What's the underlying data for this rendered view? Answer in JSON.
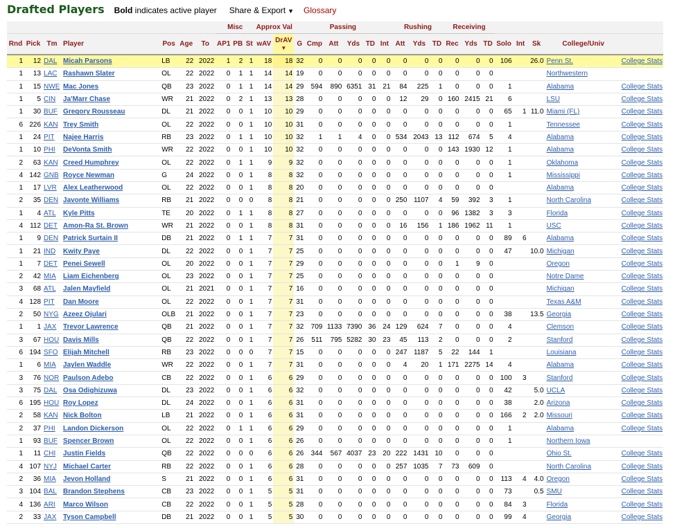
{
  "header": {
    "title": "Drafted Players",
    "note_bold": "Bold",
    "note_rest": " indicates active player",
    "share_label": "Share & Export",
    "glossary_label": "Glossary"
  },
  "groups": {
    "misc": "Misc",
    "approx": "Approx Val",
    "passing": "Passing",
    "rushing": "Rushing",
    "receiving": "Receiving"
  },
  "columns": [
    "Rnd",
    "Pick",
    "Tm",
    "Player",
    "Pos",
    "Age",
    "To",
    "AP1",
    "PB",
    "St",
    "wAV",
    "DrAV",
    "G",
    "Cmp",
    "Att",
    "Yds",
    "TD",
    "Int",
    "Att",
    "Yds",
    "TD",
    "Rec",
    "Yds",
    "TD",
    "Solo",
    "Int",
    "Sk",
    "College/Univ",
    ""
  ],
  "sort_arrow": "▼",
  "college_stats_label": "College Stats",
  "rows": [
    [
      "1",
      "12",
      "DAL",
      "Micah Parsons",
      "LB",
      "22",
      "2022",
      "1",
      "2",
      "1",
      "18",
      "18",
      "32",
      "0",
      "0",
      "0",
      "0",
      "0",
      "0",
      "0",
      "0",
      "0",
      "0",
      "0",
      "106",
      "",
      "26.0",
      "Penn St.",
      "y"
    ],
    [
      "1",
      "13",
      "LAC",
      "Rashawn Slater",
      "OL",
      "22",
      "2022",
      "0",
      "1",
      "1",
      "14",
      "14",
      "19",
      "0",
      "0",
      "0",
      "0",
      "0",
      "0",
      "0",
      "0",
      "0",
      "0",
      "0",
      "",
      "",
      "",
      "Northwestern",
      "n"
    ],
    [
      "1",
      "15",
      "NWE",
      "Mac Jones",
      "QB",
      "23",
      "2022",
      "0",
      "1",
      "1",
      "14",
      "14",
      "29",
      "594",
      "890",
      "6351",
      "31",
      "21",
      "84",
      "225",
      "1",
      "0",
      "0",
      "0",
      "1",
      "",
      "",
      "Alabama",
      "y"
    ],
    [
      "1",
      "5",
      "CIN",
      "Ja'Marr Chase",
      "WR",
      "21",
      "2022",
      "0",
      "2",
      "1",
      "13",
      "13",
      "28",
      "0",
      "0",
      "0",
      "0",
      "0",
      "12",
      "29",
      "0",
      "160",
      "2415",
      "21",
      "6",
      "",
      "",
      "LSU",
      "y"
    ],
    [
      "1",
      "30",
      "BUF",
      "Gregory Rousseau",
      "DL",
      "21",
      "2022",
      "0",
      "0",
      "1",
      "10",
      "10",
      "29",
      "0",
      "0",
      "0",
      "0",
      "0",
      "0",
      "0",
      "0",
      "0",
      "0",
      "0",
      "65",
      "1",
      "11.0",
      "Miami (FL)",
      "y"
    ],
    [
      "6",
      "226",
      "KAN",
      "Trey Smith",
      "OL",
      "22",
      "2022",
      "0",
      "0",
      "1",
      "10",
      "10",
      "31",
      "0",
      "0",
      "0",
      "0",
      "0",
      "0",
      "0",
      "0",
      "0",
      "0",
      "0",
      "1",
      "",
      "",
      "Tennessee",
      "y"
    ],
    [
      "1",
      "24",
      "PIT",
      "Najee Harris",
      "RB",
      "23",
      "2022",
      "0",
      "1",
      "1",
      "10",
      "10",
      "32",
      "1",
      "1",
      "4",
      "0",
      "0",
      "534",
      "2043",
      "13",
      "112",
      "674",
      "5",
      "4",
      "",
      "",
      "Alabama",
      "y"
    ],
    [
      "1",
      "10",
      "PHI",
      "DeVonta Smith",
      "WR",
      "22",
      "2022",
      "0",
      "0",
      "1",
      "10",
      "10",
      "32",
      "0",
      "0",
      "0",
      "0",
      "0",
      "0",
      "0",
      "0",
      "143",
      "1930",
      "12",
      "1",
      "",
      "",
      "Alabama",
      "y"
    ],
    [
      "2",
      "63",
      "KAN",
      "Creed Humphrey",
      "OL",
      "22",
      "2022",
      "0",
      "1",
      "1",
      "9",
      "9",
      "32",
      "0",
      "0",
      "0",
      "0",
      "0",
      "0",
      "0",
      "0",
      "0",
      "0",
      "0",
      "1",
      "",
      "",
      "Oklahoma",
      "y"
    ],
    [
      "4",
      "142",
      "GNB",
      "Royce Newman",
      "G",
      "24",
      "2022",
      "0",
      "0",
      "1",
      "8",
      "8",
      "32",
      "0",
      "0",
      "0",
      "0",
      "0",
      "0",
      "0",
      "0",
      "0",
      "0",
      "0",
      "1",
      "",
      "",
      "Mississippi",
      "y"
    ],
    [
      "1",
      "17",
      "LVR",
      "Alex Leatherwood",
      "OL",
      "22",
      "2022",
      "0",
      "0",
      "1",
      "8",
      "8",
      "20",
      "0",
      "0",
      "0",
      "0",
      "0",
      "0",
      "0",
      "0",
      "0",
      "0",
      "0",
      "",
      "",
      "",
      "Alabama",
      "y"
    ],
    [
      "2",
      "35",
      "DEN",
      "Javonte Williams",
      "RB",
      "21",
      "2022",
      "0",
      "0",
      "0",
      "8",
      "8",
      "21",
      "0",
      "0",
      "0",
      "0",
      "0",
      "250",
      "1107",
      "4",
      "59",
      "392",
      "3",
      "1",
      "",
      "",
      "North Carolina",
      "y"
    ],
    [
      "1",
      "4",
      "ATL",
      "Kyle Pitts",
      "TE",
      "20",
      "2022",
      "0",
      "1",
      "1",
      "8",
      "8",
      "27",
      "0",
      "0",
      "0",
      "0",
      "0",
      "0",
      "0",
      "0",
      "96",
      "1382",
      "3",
      "3",
      "",
      "",
      "Florida",
      "y"
    ],
    [
      "4",
      "112",
      "DET",
      "Amon-Ra St. Brown",
      "WR",
      "21",
      "2022",
      "0",
      "0",
      "1",
      "8",
      "8",
      "31",
      "0",
      "0",
      "0",
      "0",
      "0",
      "16",
      "156",
      "1",
      "186",
      "1962",
      "11",
      "1",
      "",
      "",
      "USC",
      "y"
    ],
    [
      "1",
      "9",
      "DEN",
      "Patrick Surtain II",
      "DB",
      "21",
      "2022",
      "0",
      "1",
      "1",
      "7",
      "7",
      "31",
      "0",
      "0",
      "0",
      "0",
      "0",
      "0",
      "0",
      "0",
      "0",
      "0",
      "0",
      "89",
      "6",
      "",
      "Alabama",
      "y"
    ],
    [
      "1",
      "21",
      "IND",
      "Kwity Paye",
      "DL",
      "22",
      "2022",
      "0",
      "0",
      "1",
      "7",
      "7",
      "25",
      "0",
      "0",
      "0",
      "0",
      "0",
      "0",
      "0",
      "0",
      "0",
      "0",
      "0",
      "47",
      "",
      "10.0",
      "Michigan",
      "y"
    ],
    [
      "1",
      "7",
      "DET",
      "Penei Sewell",
      "OL",
      "20",
      "2022",
      "0",
      "0",
      "1",
      "7",
      "7",
      "29",
      "0",
      "0",
      "0",
      "0",
      "0",
      "0",
      "0",
      "0",
      "1",
      "9",
      "0",
      "",
      "",
      "",
      "Oregon",
      "y"
    ],
    [
      "2",
      "42",
      "MIA",
      "Liam Eichenberg",
      "OL",
      "23",
      "2022",
      "0",
      "0",
      "1",
      "7",
      "7",
      "25",
      "0",
      "0",
      "0",
      "0",
      "0",
      "0",
      "0",
      "0",
      "0",
      "0",
      "0",
      "",
      "",
      "",
      "Notre Dame",
      "y"
    ],
    [
      "3",
      "68",
      "ATL",
      "Jalen Mayfield",
      "OL",
      "21",
      "2021",
      "0",
      "0",
      "1",
      "7",
      "7",
      "16",
      "0",
      "0",
      "0",
      "0",
      "0",
      "0",
      "0",
      "0",
      "0",
      "0",
      "0",
      "",
      "",
      "",
      "Michigan",
      "y"
    ],
    [
      "4",
      "128",
      "PIT",
      "Dan Moore",
      "OL",
      "22",
      "2022",
      "0",
      "0",
      "1",
      "7",
      "7",
      "31",
      "0",
      "0",
      "0",
      "0",
      "0",
      "0",
      "0",
      "0",
      "0",
      "0",
      "0",
      "",
      "",
      "",
      "Texas A&M",
      "y"
    ],
    [
      "2",
      "50",
      "NYG",
      "Azeez Ojulari",
      "OLB",
      "21",
      "2022",
      "0",
      "0",
      "1",
      "7",
      "7",
      "23",
      "0",
      "0",
      "0",
      "0",
      "0",
      "0",
      "0",
      "0",
      "0",
      "0",
      "0",
      "38",
      "",
      "13.5",
      "Georgia",
      "y"
    ],
    [
      "1",
      "1",
      "JAX",
      "Trevor Lawrence",
      "QB",
      "21",
      "2022",
      "0",
      "0",
      "1",
      "7",
      "7",
      "32",
      "709",
      "1133",
      "7390",
      "36",
      "24",
      "129",
      "624",
      "7",
      "0",
      "0",
      "0",
      "4",
      "",
      "",
      "Clemson",
      "y"
    ],
    [
      "3",
      "67",
      "HOU",
      "Davis Mills",
      "QB",
      "22",
      "2022",
      "0",
      "0",
      "1",
      "7",
      "7",
      "26",
      "511",
      "795",
      "5282",
      "30",
      "23",
      "45",
      "113",
      "2",
      "0",
      "0",
      "0",
      "2",
      "",
      "",
      "Stanford",
      "y"
    ],
    [
      "6",
      "194",
      "SFO",
      "Elijah Mitchell",
      "RB",
      "23",
      "2022",
      "0",
      "0",
      "0",
      "7",
      "7",
      "15",
      "0",
      "0",
      "0",
      "0",
      "0",
      "247",
      "1187",
      "5",
      "22",
      "144",
      "1",
      "",
      "",
      "",
      "Louisiana",
      "y"
    ],
    [
      "1",
      "6",
      "MIA",
      "Jaylen Waddle",
      "WR",
      "22",
      "2022",
      "0",
      "0",
      "1",
      "7",
      "7",
      "31",
      "0",
      "0",
      "0",
      "0",
      "0",
      "4",
      "20",
      "1",
      "171",
      "2275",
      "14",
      "4",
      "",
      "",
      "Alabama",
      "y"
    ],
    [
      "3",
      "76",
      "NOR",
      "Paulson Adebo",
      "CB",
      "22",
      "2022",
      "0",
      "0",
      "1",
      "6",
      "6",
      "29",
      "0",
      "0",
      "0",
      "0",
      "0",
      "0",
      "0",
      "0",
      "0",
      "0",
      "0",
      "100",
      "3",
      "",
      "Stanford",
      "y"
    ],
    [
      "3",
      "75",
      "DAL",
      "Osa Odighizuwa",
      "DL",
      "23",
      "2022",
      "0",
      "0",
      "1",
      "6",
      "6",
      "32",
      "0",
      "0",
      "0",
      "0",
      "0",
      "0",
      "0",
      "0",
      "0",
      "0",
      "0",
      "42",
      "",
      "5.0",
      "UCLA",
      "y"
    ],
    [
      "6",
      "195",
      "HOU",
      "Roy Lopez",
      "DL",
      "24",
      "2022",
      "0",
      "0",
      "1",
      "6",
      "6",
      "31",
      "0",
      "0",
      "0",
      "0",
      "0",
      "0",
      "0",
      "0",
      "0",
      "0",
      "0",
      "38",
      "",
      "2.0",
      "Arizona",
      "y"
    ],
    [
      "2",
      "58",
      "KAN",
      "Nick Bolton",
      "LB",
      "21",
      "2022",
      "0",
      "0",
      "1",
      "6",
      "6",
      "31",
      "0",
      "0",
      "0",
      "0",
      "0",
      "0",
      "0",
      "0",
      "0",
      "0",
      "0",
      "166",
      "2",
      "2.0",
      "Missouri",
      "y"
    ],
    [
      "2",
      "37",
      "PHI",
      "Landon Dickerson",
      "OL",
      "22",
      "2022",
      "0",
      "1",
      "1",
      "6",
      "6",
      "29",
      "0",
      "0",
      "0",
      "0",
      "0",
      "0",
      "0",
      "0",
      "0",
      "0",
      "0",
      "1",
      "",
      "",
      "Alabama",
      "y"
    ],
    [
      "1",
      "93",
      "BUF",
      "Spencer Brown",
      "OL",
      "22",
      "2022",
      "0",
      "0",
      "1",
      "6",
      "6",
      "26",
      "0",
      "0",
      "0",
      "0",
      "0",
      "0",
      "0",
      "0",
      "0",
      "0",
      "0",
      "1",
      "",
      "",
      "Northern Iowa",
      "n"
    ],
    [
      "1",
      "11",
      "CHI",
      "Justin Fields",
      "QB",
      "22",
      "2022",
      "0",
      "0",
      "0",
      "6",
      "6",
      "26",
      "344",
      "567",
      "4037",
      "23",
      "20",
      "222",
      "1431",
      "10",
      "0",
      "0",
      "0",
      "",
      "",
      "",
      "Ohio St.",
      "y"
    ],
    [
      "4",
      "107",
      "NYJ",
      "Michael Carter",
      "RB",
      "22",
      "2022",
      "0",
      "0",
      "1",
      "6",
      "6",
      "28",
      "0",
      "0",
      "0",
      "0",
      "0",
      "257",
      "1035",
      "7",
      "73",
      "609",
      "0",
      "",
      "",
      "",
      "North Carolina",
      "y"
    ],
    [
      "2",
      "36",
      "MIA",
      "Jevon Holland",
      "S",
      "21",
      "2022",
      "0",
      "0",
      "1",
      "6",
      "6",
      "31",
      "0",
      "0",
      "0",
      "0",
      "0",
      "0",
      "0",
      "0",
      "0",
      "0",
      "0",
      "113",
      "4",
      "4.0",
      "Oregon",
      "y"
    ],
    [
      "3",
      "104",
      "BAL",
      "Brandon Stephens",
      "CB",
      "23",
      "2022",
      "0",
      "0",
      "1",
      "5",
      "5",
      "31",
      "0",
      "0",
      "0",
      "0",
      "0",
      "0",
      "0",
      "0",
      "0",
      "0",
      "0",
      "73",
      "",
      "0.5",
      "SMU",
      "y"
    ],
    [
      "4",
      "136",
      "ARI",
      "Marco Wilson",
      "CB",
      "22",
      "2022",
      "0",
      "0",
      "1",
      "5",
      "5",
      "28",
      "0",
      "0",
      "0",
      "0",
      "0",
      "0",
      "0",
      "0",
      "0",
      "0",
      "0",
      "84",
      "3",
      "",
      "Florida",
      "y"
    ],
    [
      "2",
      "33",
      "JAX",
      "Tyson Campbell",
      "DB",
      "21",
      "2022",
      "0",
      "0",
      "1",
      "5",
      "5",
      "30",
      "0",
      "0",
      "0",
      "0",
      "0",
      "0",
      "0",
      "0",
      "0",
      "0",
      "0",
      "99",
      "4",
      "",
      "Georgia",
      "y"
    ]
  ]
}
